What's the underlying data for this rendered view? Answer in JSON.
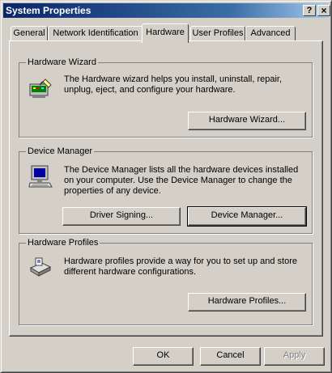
{
  "window": {
    "title": "System Properties",
    "help_button": "?",
    "close_button": "×"
  },
  "tabs": [
    {
      "label": "General",
      "active": false
    },
    {
      "label": "Network Identification",
      "active": false
    },
    {
      "label": "Hardware",
      "active": true
    },
    {
      "label": "User Profiles",
      "active": false
    },
    {
      "label": "Advanced",
      "active": false
    }
  ],
  "hardware_wizard": {
    "group_label": "Hardware Wizard",
    "icon": "hardware-wizard-icon",
    "description": "The Hardware wizard helps you install, uninstall, repair, unplug, eject, and configure your hardware.",
    "button": "Hardware Wizard..."
  },
  "device_manager": {
    "group_label": "Device Manager",
    "icon": "computer-icon",
    "description": "The Device Manager lists all the hardware devices installed on your computer. Use the Device Manager to change the properties of any device.",
    "driver_signing_button": "Driver Signing...",
    "device_manager_button": "Device Manager..."
  },
  "hardware_profiles": {
    "group_label": "Hardware Profiles",
    "icon": "hardware-profiles-icon",
    "description": "Hardware profiles provide a way for you to set up and store different hardware configurations.",
    "button": "Hardware Profiles..."
  },
  "footer": {
    "ok": "OK",
    "cancel": "Cancel",
    "apply": "Apply",
    "apply_enabled": false
  }
}
